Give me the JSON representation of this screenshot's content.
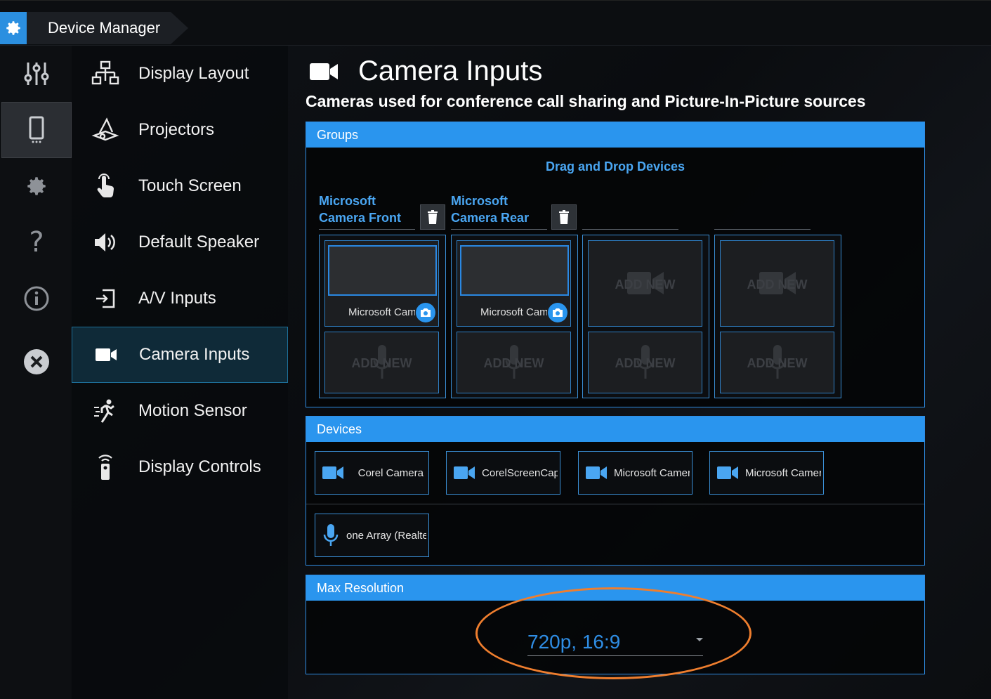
{
  "app": {
    "title": "Device Manager"
  },
  "rail": {
    "items": [
      "sliders",
      "device",
      "settings",
      "help",
      "info",
      "close"
    ]
  },
  "menu": {
    "items": [
      {
        "label": "Display Layout",
        "icon": "display-layout-icon"
      },
      {
        "label": "Projectors",
        "icon": "projector-icon"
      },
      {
        "label": "Touch Screen",
        "icon": "touch-icon"
      },
      {
        "label": "Default Speaker",
        "icon": "speaker-icon"
      },
      {
        "label": "A/V Inputs",
        "icon": "input-icon"
      },
      {
        "label": "Camera Inputs",
        "icon": "camera-icon"
      },
      {
        "label": "Motion Sensor",
        "icon": "motion-icon"
      },
      {
        "label": "Display Controls",
        "icon": "remote-icon"
      }
    ],
    "active": "Camera Inputs"
  },
  "page": {
    "title": "Camera Inputs",
    "subtitle": "Cameras used for conference call sharing and Picture-In-Picture sources"
  },
  "groups": {
    "header": "Groups",
    "dnd_label": "Drag and Drop Devices",
    "columns": [
      {
        "title_line1": "Microsoft",
        "title_line2": "Camera Front",
        "camera": "Microsoft Camera Front",
        "mic_add": "ADD NEW"
      },
      {
        "title_line1": "Microsoft",
        "title_line2": "Camera Rear",
        "camera": "Microsoft Camera Rear",
        "mic_add": "ADD NEW"
      },
      {
        "title_line1": "",
        "title_line2": "",
        "camera_add": "ADD NEW",
        "mic_add": "ADD NEW"
      },
      {
        "title_line1": "",
        "title_line2": "",
        "camera_add": "ADD NEW",
        "mic_add": "ADD NEW"
      }
    ]
  },
  "devices": {
    "header": "Devices",
    "cameras": [
      "Corel Camera",
      "CorelScreenCap",
      "Microsoft Camera Front",
      "Microsoft Camera Rear"
    ],
    "mics": [
      "one Array (Realtek"
    ]
  },
  "resolution": {
    "header": "Max Resolution",
    "selected": "720p, 16:9"
  },
  "colors": {
    "accent": "#2a95ee",
    "highlight_ring": "#ef7e2e"
  }
}
